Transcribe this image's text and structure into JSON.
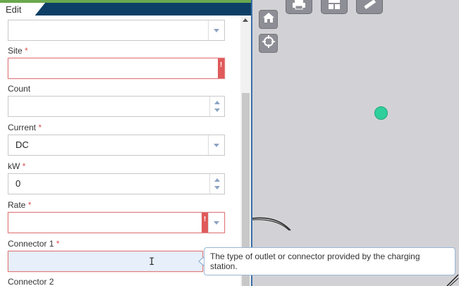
{
  "panel": {
    "tab_label": "Edit",
    "required_marker": "*"
  },
  "fields": {
    "top_dropdown": {
      "value": ""
    },
    "site": {
      "label": "Site",
      "value": "",
      "error_glyph": "!"
    },
    "count": {
      "label": "Count",
      "value": ""
    },
    "current": {
      "label": "Current",
      "value": "DC"
    },
    "kw": {
      "label": "kW",
      "value": "0"
    },
    "rate": {
      "label": "Rate",
      "value": "",
      "error_glyph": "!"
    },
    "connector1": {
      "label": "Connector 1",
      "value": ""
    },
    "connector2": {
      "label": "Connector 2"
    }
  },
  "tooltip": {
    "text": "The type of outlet or connector provided by the charging station."
  },
  "map": {
    "tools": [
      "home-icon",
      "locate-icon",
      "print-icon",
      "basemap-icon",
      "measure-icon"
    ],
    "point_color": "#2ecf9a"
  },
  "colors": {
    "header": "#0d3f66",
    "accent_green": "#6aa84f",
    "error": "#e05a5a"
  }
}
